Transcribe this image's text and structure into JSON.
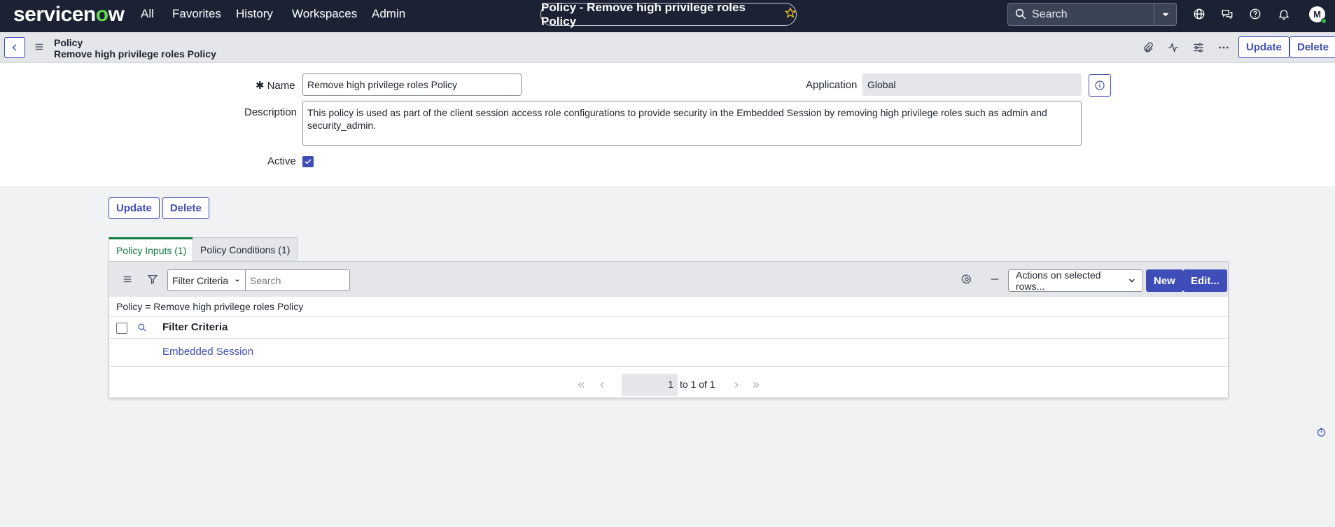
{
  "nav": {
    "logo_text_a": "servicen",
    "logo_text_o": "o",
    "logo_text_b": "w",
    "links": [
      "All",
      "Favorites",
      "History",
      "Workspaces",
      "Admin"
    ],
    "title": "Policy - Remove high privilege roles Policy",
    "search_placeholder": "Search",
    "avatar_initial": "M"
  },
  "record": {
    "type": "Policy",
    "name": "Remove high privilege roles Policy",
    "update_label": "Update",
    "delete_label": "Delete"
  },
  "form": {
    "name_label": "Name",
    "name_value": "Remove high privilege roles Policy",
    "application_label": "Application",
    "application_value": "Global",
    "description_label": "Description",
    "description_value": "This policy is used as part of the client session access role configurations to provide security in the Embedded Session by removing high privilege roles such as admin and security_admin.",
    "active_label": "Active",
    "active_checked": true
  },
  "actions": {
    "update_label": "Update",
    "delete_label": "Delete"
  },
  "tabs": [
    {
      "label": "Policy Inputs (1)",
      "active": true
    },
    {
      "label": "Policy Conditions (1)",
      "active": false
    }
  ],
  "list": {
    "filter_select": "Filter Criteria",
    "search_placeholder": "Search",
    "actions_select": "Actions on selected rows...",
    "new_label": "New",
    "edit_label": "Edit...",
    "breadcrumb": "Policy = Remove high privilege roles Policy",
    "column": "Filter Criteria",
    "rows": [
      "Embedded Session"
    ],
    "page_value": "1",
    "page_total": "to 1 of 1"
  },
  "colors": {
    "nav_bg": "#1a2233",
    "accent": "#3f4db8",
    "tab_active": "#0e7a3e"
  }
}
